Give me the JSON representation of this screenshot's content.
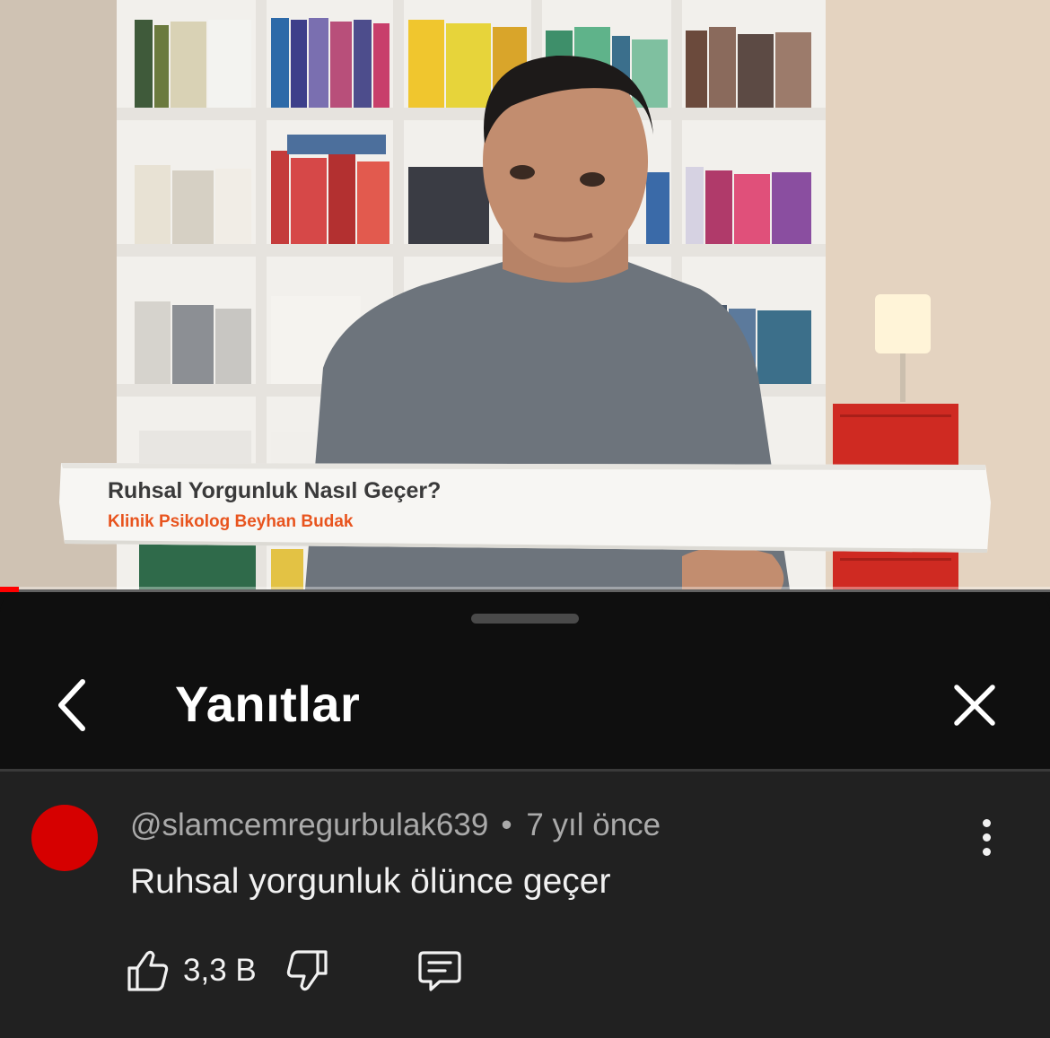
{
  "video": {
    "lower_third_title": "Ruhsal Yorgunluk Nasıl Geçer?",
    "lower_third_subtitle": "Klinik Psikolog Beyhan Budak",
    "progress_fraction": 0.018
  },
  "sheet": {
    "title": "Yanıtlar",
    "back_icon": "chevron-left-icon",
    "close_icon": "close-icon"
  },
  "comment": {
    "author": "@slamcemregurbulak639",
    "separator": "•",
    "time": "7 yıl önce",
    "text": "Ruhsal yorgunluk ölünce geçer",
    "like_count": "3,3 B",
    "avatar_color": "#d60000"
  },
  "colors": {
    "background": "#0f0f0f",
    "comment_background": "#212121",
    "accent": "#ff0000",
    "lower_third_accent": "#e8541e"
  }
}
